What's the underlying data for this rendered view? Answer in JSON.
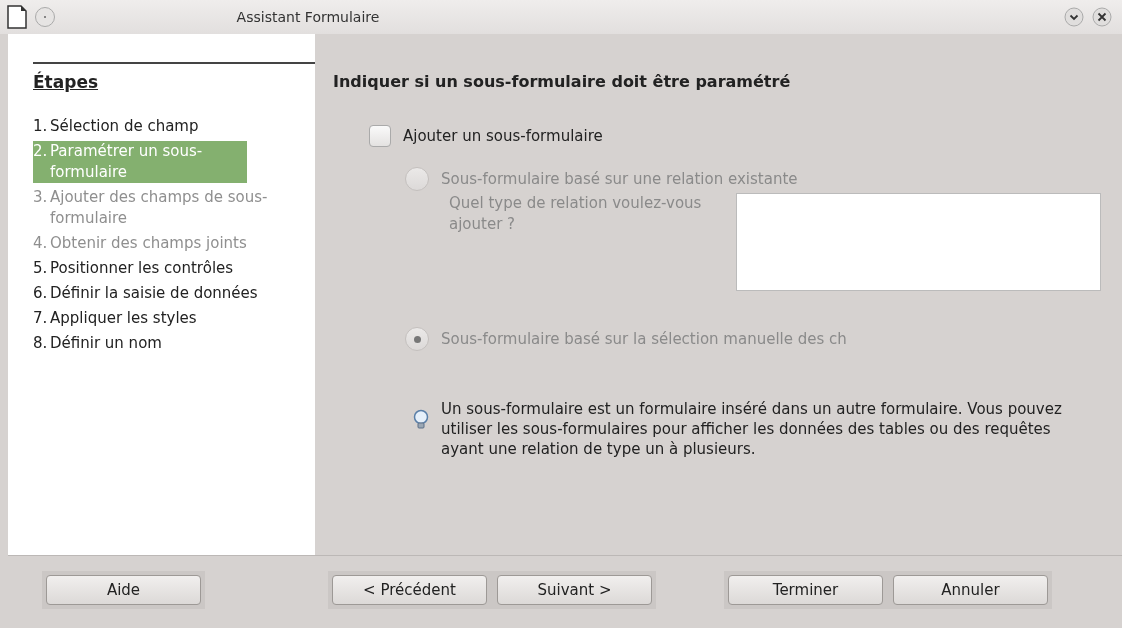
{
  "window": {
    "title": "Assistant Formulaire"
  },
  "sidebar": {
    "heading": "Étapes",
    "steps": [
      {
        "number": "1.",
        "label": "Sélection de champ",
        "selected": false,
        "disabled": false
      },
      {
        "number": "2.",
        "label": "Paramétrer un sous-formulaire",
        "selected": true,
        "disabled": false
      },
      {
        "number": "3.",
        "label": "Ajouter des champs de sous-formulaire",
        "selected": false,
        "disabled": true
      },
      {
        "number": "4.",
        "label": "Obtenir des champs joints",
        "selected": false,
        "disabled": true
      },
      {
        "number": "5.",
        "label": "Positionner les contrôles",
        "selected": false,
        "disabled": false
      },
      {
        "number": "6.",
        "label": "Définir la saisie de données",
        "selected": false,
        "disabled": false
      },
      {
        "number": "7.",
        "label": "Appliquer les styles",
        "selected": false,
        "disabled": false
      },
      {
        "number": "8.",
        "label": "Définir un nom",
        "selected": false,
        "disabled": false
      }
    ]
  },
  "content": {
    "heading": "Indiquer si un sous-formulaire doit être paramétré",
    "add_subform": {
      "label": "Ajouter un sous-formulaire",
      "checked": false
    },
    "options": [
      {
        "label": "Sous-formulaire basé sur une relation existante",
        "selected": false,
        "disabled": true
      },
      {
        "label": "Sous-formulaire basé sur la sélection manuelle des ch",
        "selected": true,
        "disabled": true
      }
    ],
    "relation_label": "Quel type de relation voulez-vous ajouter ?",
    "info": "Un sous-formulaire est un formulaire inséré dans un autre formulaire. Vous pouvez utiliser les sous-formulaires pour afficher les données des tables ou des requêtes ayant une relation de type un à plusieurs."
  },
  "button_groups": [
    [
      "Aide"
    ],
    [
      "< Précédent",
      "Suivant >"
    ],
    [
      "Terminer",
      "Annuler"
    ]
  ]
}
